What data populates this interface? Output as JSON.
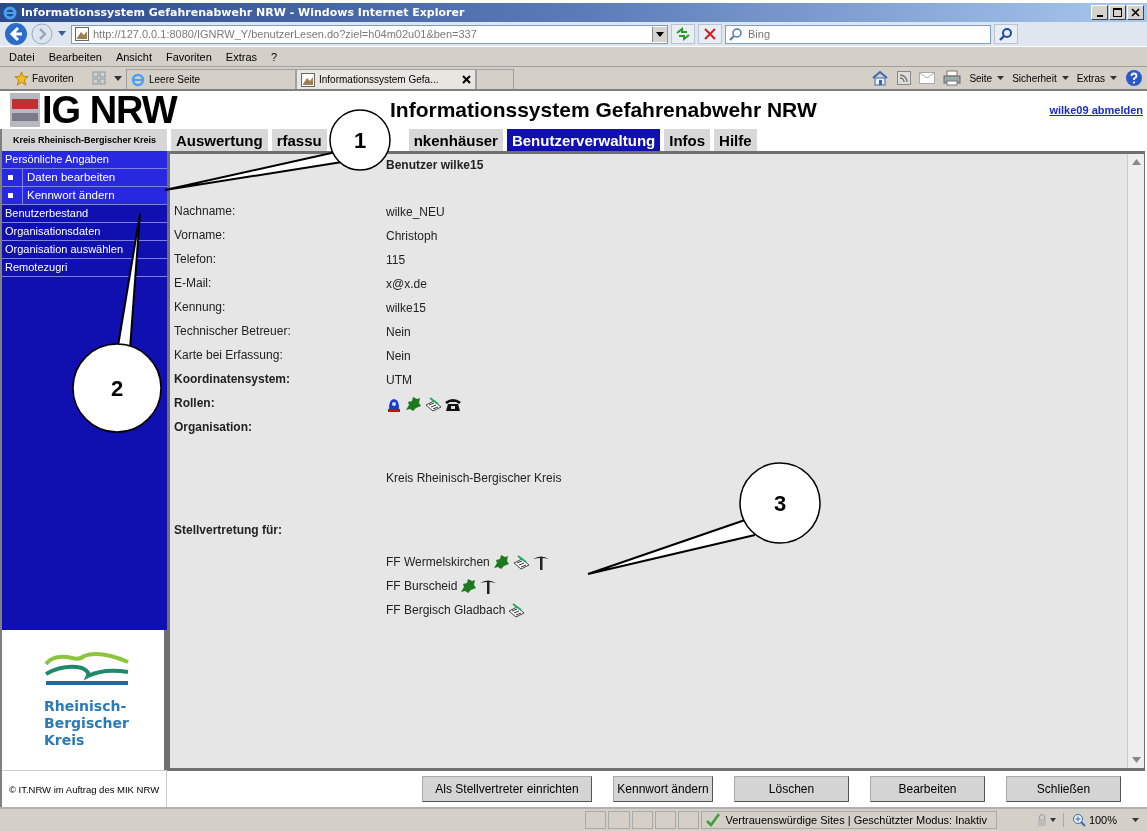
{
  "window": {
    "title": "Informationssystem Gefahrenabwehr NRW - Windows Internet Explorer"
  },
  "address_bar": {
    "url": "http://127.0.0.1:8080/IGNRW_Y/benutzerLesen.do?ziel=h04m02u01&ben=337",
    "search_placeholder": "Bing"
  },
  "menu_bar": [
    "Datei",
    "Bearbeiten",
    "Ansicht",
    "Favoriten",
    "Extras",
    "?"
  ],
  "favorites_bar": {
    "favorites": "Favoriten",
    "tabs": [
      {
        "label": "Leere Seite",
        "selected": false
      },
      {
        "label": "Informationssystem Gefa...",
        "selected": true
      }
    ],
    "commands": [
      "Seite",
      "Sicherheit",
      "Extras"
    ]
  },
  "page": {
    "logo": "IG NRW",
    "title": "Informationssystem Gefahrenabwehr NRW",
    "logout": "wilke09 abmelden"
  },
  "sidebar": {
    "organisation": "Kreis Rheinisch-Bergischer Kreis",
    "items": [
      {
        "label": "Persönliche Angaben",
        "kind": "item",
        "selected": true
      },
      {
        "label": "Daten bearbeiten",
        "kind": "subitem",
        "selected": false
      },
      {
        "label": "Kennwort ändern",
        "kind": "subitem",
        "selected": false
      },
      {
        "label": "Benutzerbestand",
        "kind": "item",
        "selected": false
      },
      {
        "label": "Organisationsdaten",
        "kind": "item",
        "selected": false
      },
      {
        "label": "Organisation auswählen",
        "kind": "item",
        "selected": false
      },
      {
        "label": "Remotezugri",
        "kind": "item",
        "selected": false
      }
    ],
    "logo_lines": [
      "Rheinisch-",
      "Bergischer",
      "Kreis"
    ],
    "copyright": "© IT.NRW im Auftrag des MIK NRW"
  },
  "tabs": [
    {
      "label": "Auswertung",
      "selected": false
    },
    {
      "label": "rfassu",
      "selected": false
    },
    {
      "label": "nkenhäuser",
      "selected": false
    },
    {
      "label": "Benutzerverwaltung",
      "selected": true
    },
    {
      "label": "Infos",
      "selected": false
    },
    {
      "label": "Hilfe",
      "selected": false
    }
  ],
  "content": {
    "title": "Benutzer wilke15",
    "fields": [
      {
        "label": "Nachname:",
        "value": "wilke_NEU",
        "bold": false
      },
      {
        "label": "Vorname:",
        "value": "Christoph",
        "bold": false
      },
      {
        "label": "Telefon:",
        "value": "115",
        "bold": false
      },
      {
        "label": "E-Mail:",
        "value": "x@x.de",
        "bold": false
      },
      {
        "label": "Kennung:",
        "value": "wilke15",
        "bold": false
      },
      {
        "label": "Technischer Betreuer:",
        "value": "Nein",
        "bold": false
      },
      {
        "label": "Karte bei Erfassung:",
        "value": "Nein",
        "bold": false
      },
      {
        "label": "Koordinatensystem:",
        "value": "UTM",
        "bold": true
      }
    ],
    "roles": {
      "label": "Rollen:",
      "icons": [
        {
          "kind": "beacon"
        },
        {
          "kind": "region"
        },
        {
          "kind": "notes"
        },
        {
          "kind": "phone"
        }
      ]
    },
    "organisation": {
      "label": "Organisation:",
      "value": "Kreis Rheinisch-Bergischer Kreis"
    },
    "deputies": {
      "label": "Stellvertretung für:",
      "entries": [
        {
          "name": "FF Wermelskirchen",
          "icons": [
            {
              "kind": "region"
            },
            {
              "kind": "notes"
            },
            {
              "kind": "umbrella"
            }
          ]
        },
        {
          "name": "FF Burscheid",
          "icons": [
            {
              "kind": "region"
            },
            {
              "kind": "umbrella"
            }
          ]
        },
        {
          "name": "FF Bergisch Gladbach",
          "icons": [
            {
              "kind": "notes"
            }
          ]
        }
      ]
    }
  },
  "buttons": [
    "Als Stellvertreter einrichten",
    "Kennwort ändern",
    "Löschen",
    "Bearbeiten",
    "Schließen"
  ],
  "status_bar": {
    "zone": "Vertrauenswürdige Sites | Geschützter Modus: Inaktiv",
    "zoom": "100%"
  },
  "callouts": [
    "1",
    "2",
    "3"
  ]
}
